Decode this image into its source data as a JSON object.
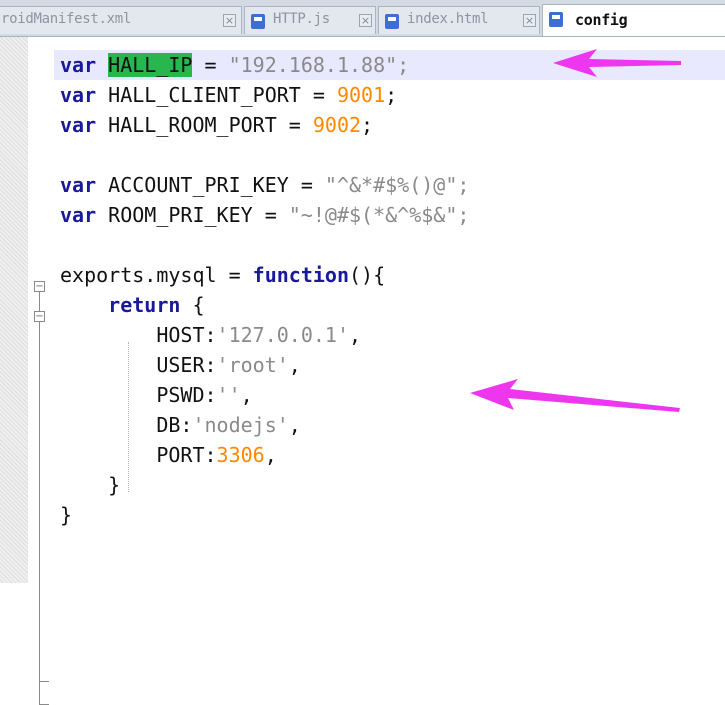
{
  "tabs": [
    {
      "label": "roidManifest.xml",
      "active": false
    },
    {
      "label": "HTTP.js",
      "active": false
    },
    {
      "label": "index.html",
      "active": false
    },
    {
      "label": "config",
      "active": true
    }
  ],
  "editor": {
    "lines": [
      {
        "tokens": [
          [
            "kw",
            "var"
          ],
          [
            "t",
            " "
          ],
          [
            "hl",
            "HALL_IP"
          ],
          [
            "t",
            " = "
          ],
          [
            "str",
            "\"192.168.1.88\";"
          ]
        ]
      },
      {
        "tokens": [
          [
            "kw",
            "var"
          ],
          [
            "t",
            " HALL_CLIENT_PORT = "
          ],
          [
            "num",
            "9001"
          ],
          [
            "t",
            ";"
          ]
        ]
      },
      {
        "tokens": [
          [
            "kw",
            "var"
          ],
          [
            "t",
            " HALL_ROOM_PORT = "
          ],
          [
            "num",
            "9002"
          ],
          [
            "t",
            ";"
          ]
        ]
      },
      {
        "tokens": []
      },
      {
        "tokens": [
          [
            "kw",
            "var"
          ],
          [
            "t",
            " ACCOUNT_PRI_KEY = "
          ],
          [
            "str",
            "\"^&*#$%()@\";"
          ]
        ]
      },
      {
        "tokens": [
          [
            "kw",
            "var"
          ],
          [
            "t",
            " ROOM_PRI_KEY = "
          ],
          [
            "str",
            "\"~!@#$(*&^%$&\";"
          ]
        ]
      },
      {
        "tokens": []
      },
      {
        "tokens": [
          [
            "t",
            "exports.mysql = "
          ],
          [
            "kw",
            "function"
          ],
          [
            "t",
            "(){"
          ]
        ]
      },
      {
        "tokens": [
          [
            "t",
            "    "
          ],
          [
            "kw",
            "return"
          ],
          [
            "t",
            " {"
          ]
        ]
      },
      {
        "tokens": [
          [
            "t",
            "        HOST:"
          ],
          [
            "str",
            "'127.0.0.1'"
          ],
          [
            "t",
            ","
          ]
        ]
      },
      {
        "tokens": [
          [
            "t",
            "        USER:"
          ],
          [
            "str",
            "'root'"
          ],
          [
            "t",
            ","
          ]
        ]
      },
      {
        "tokens": [
          [
            "t",
            "        PSWD:"
          ],
          [
            "str",
            "''"
          ],
          [
            "t",
            ","
          ]
        ]
      },
      {
        "tokens": [
          [
            "t",
            "        DB:"
          ],
          [
            "str",
            "'nodejs'"
          ],
          [
            "t",
            ","
          ]
        ]
      },
      {
        "tokens": [
          [
            "t",
            "        PORT:"
          ],
          [
            "num",
            "3306"
          ],
          [
            "t",
            ","
          ]
        ]
      },
      {
        "tokens": [
          [
            "t",
            "    }"
          ]
        ]
      },
      {
        "tokens": [
          [
            "t",
            "}"
          ]
        ]
      }
    ],
    "current_line": 0
  },
  "fold_markers": {
    "open": "−",
    "close": "×"
  },
  "colors": {
    "keyword": "#1a1a99",
    "string": "#8a8a8a",
    "number": "#ff8800",
    "highlight": "#2ab64e",
    "arrow": "#ee36ee"
  }
}
